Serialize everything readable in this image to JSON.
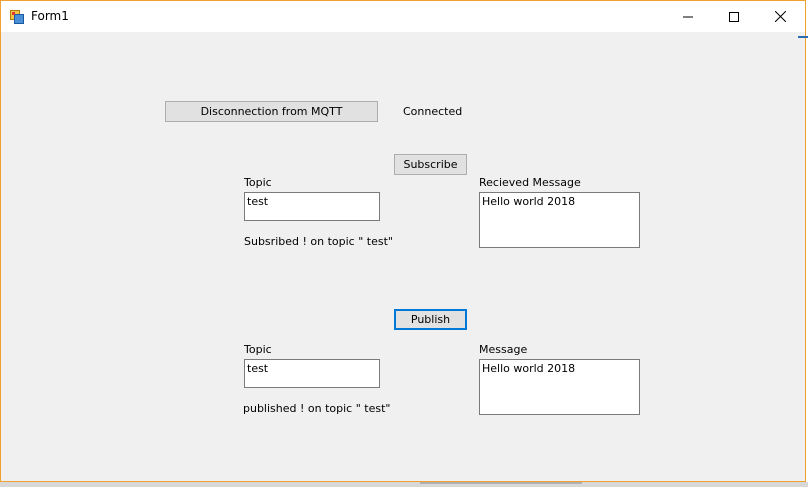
{
  "window": {
    "title": "Form1",
    "accent_color": "#f0a030"
  },
  "connection": {
    "button_label": "Disconnection from MQTT",
    "status": "Connected"
  },
  "subscribe": {
    "button_label": "Subscribe",
    "topic_label": "Topic",
    "topic_value": "test",
    "received_label": "Recieved Message",
    "received_value": "Hello world 2018",
    "status": "Subsribed ! on topic \" test\""
  },
  "publish": {
    "button_label": "Publish",
    "topic_label": "Topic",
    "topic_value": "test",
    "message_label": "Message",
    "message_value": "Hello world 2018",
    "status": "published ! on topic \" test\""
  },
  "icons": {
    "app": "app-icon",
    "minimize": "minimize-icon",
    "maximize": "maximize-icon",
    "close": "close-icon"
  },
  "colors": {
    "focus_border": "#0078d7",
    "form_background": "#f0f0f0"
  }
}
